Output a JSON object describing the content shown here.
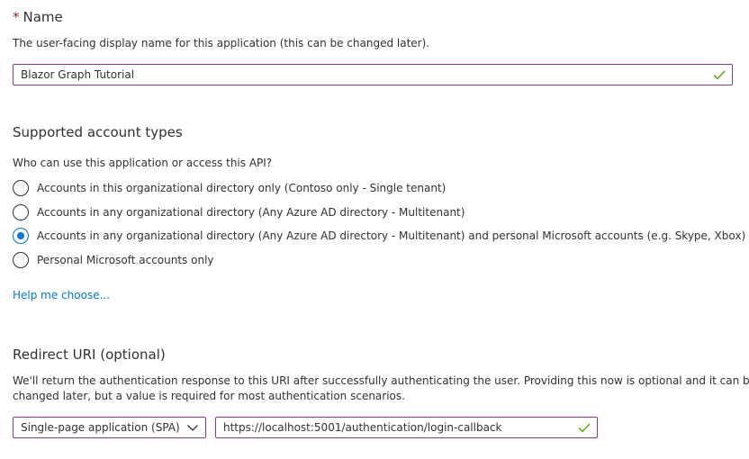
{
  "name_section": {
    "required_marker": "*",
    "title": "Name",
    "description": "The user-facing display name for this application (this can be changed later).",
    "input_value": "Blazor Graph Tutorial",
    "valid_icon": "check-icon"
  },
  "account_types": {
    "title": "Supported account types",
    "question": "Who can use this application or access this API?",
    "options": [
      {
        "label": "Accounts in this organizational directory only (Contoso only - Single tenant)",
        "selected": false
      },
      {
        "label": "Accounts in any organizational directory (Any Azure AD directory - Multitenant)",
        "selected": false
      },
      {
        "label": "Accounts in any organizational directory (Any Azure AD directory - Multitenant) and personal Microsoft accounts (e.g. Skype, Xbox)",
        "selected": true
      },
      {
        "label": "Personal Microsoft accounts only",
        "selected": false
      }
    ],
    "help_link": "Help me choose..."
  },
  "redirect_uri": {
    "title": "Redirect URI (optional)",
    "description_line1": "We'll return the authentication response to this URI after successfully authenticating the user. Providing this now is optional and it can be",
    "description_line2": "changed later, but a value is required for most authentication scenarios.",
    "platform_selected": "Single-page application (SPA)",
    "uri_value": "https://localhost:5001/authentication/login-callback",
    "valid_icon": "check-icon"
  },
  "colors": {
    "accent": "#0078d4",
    "input_border": "#8a3a8e",
    "check": "#57a300",
    "required": "#a4262c",
    "text": "#323130"
  }
}
